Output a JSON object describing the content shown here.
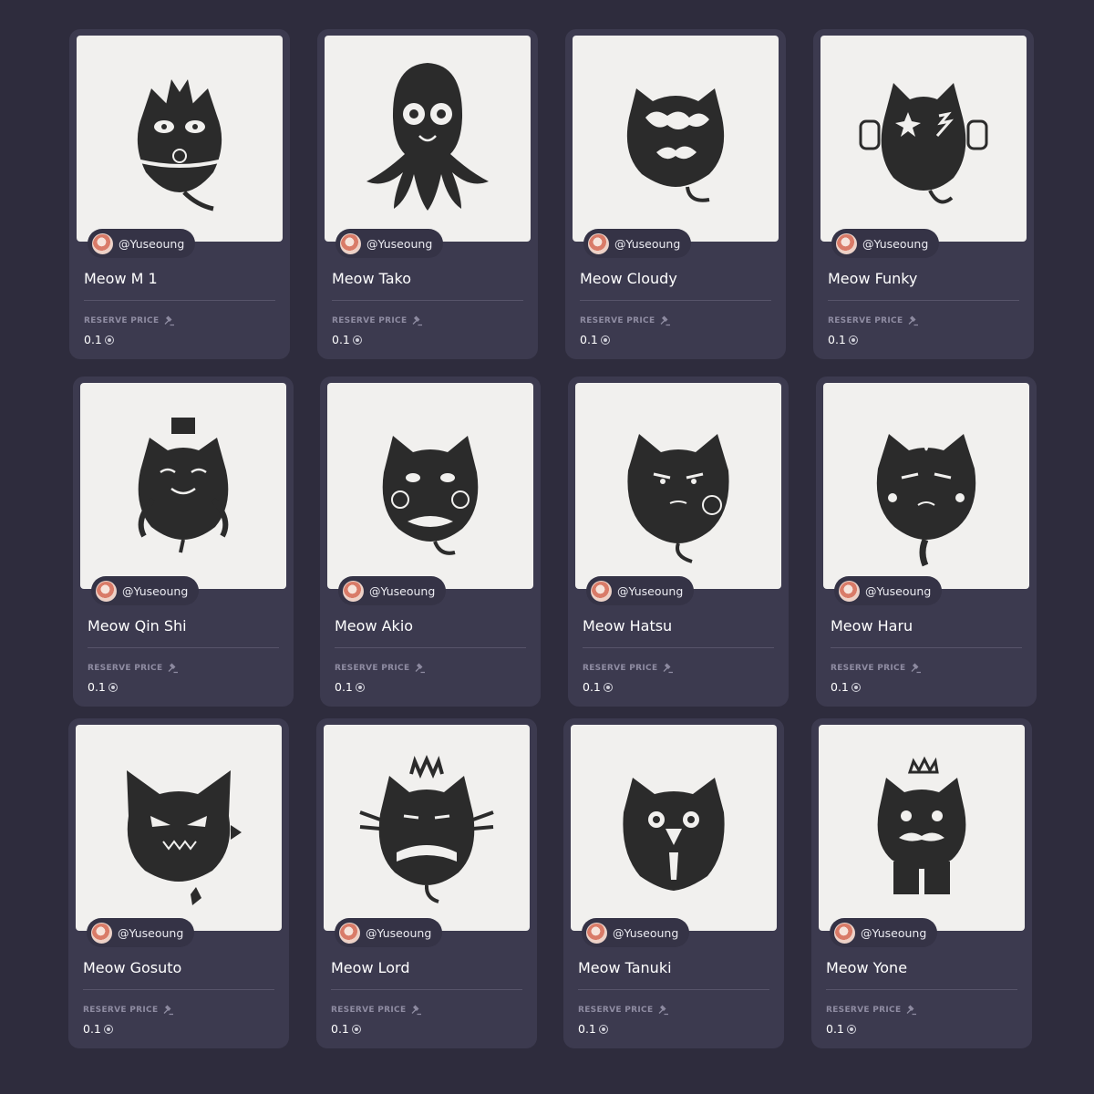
{
  "reserve_label": "RESERVE PRICE",
  "cards": [
    {
      "title": "Meow M 1",
      "creator": "@Yuseoung",
      "price": "0.1",
      "art_icon": "cat-m1-icon"
    },
    {
      "title": "Meow Tako",
      "creator": "@Yuseoung",
      "price": "0.1",
      "art_icon": "octopus-cat-icon"
    },
    {
      "title": "Meow Cloudy",
      "creator": "@Yuseoung",
      "price": "0.1",
      "art_icon": "cloudy-cat-icon"
    },
    {
      "title": "Meow Funky",
      "creator": "@Yuseoung",
      "price": "0.1",
      "art_icon": "funky-cat-icon"
    },
    {
      "title": "Meow Qin Shi",
      "creator": "@Yuseoung",
      "price": "0.1",
      "art_icon": "qin-shi-cat-icon"
    },
    {
      "title": "Meow Akio",
      "creator": "@Yuseoung",
      "price": "0.1",
      "art_icon": "akio-cat-icon"
    },
    {
      "title": "Meow Hatsu",
      "creator": "@Yuseoung",
      "price": "0.1",
      "art_icon": "hatsu-cat-icon"
    },
    {
      "title": "Meow Haru",
      "creator": "@Yuseoung",
      "price": "0.1",
      "art_icon": "haru-cat-icon"
    },
    {
      "title": "Meow Gosuto",
      "creator": "@Yuseoung",
      "price": "0.1",
      "art_icon": "gosuto-cat-icon"
    },
    {
      "title": "Meow Lord",
      "creator": "@Yuseoung",
      "price": "0.1",
      "art_icon": "lord-cat-icon"
    },
    {
      "title": "Meow Tanuki",
      "creator": "@Yuseoung",
      "price": "0.1",
      "art_icon": "tanuki-cat-icon"
    },
    {
      "title": "Meow Yone",
      "creator": "@Yuseoung",
      "price": "0.1",
      "art_icon": "yone-cat-icon"
    }
  ]
}
